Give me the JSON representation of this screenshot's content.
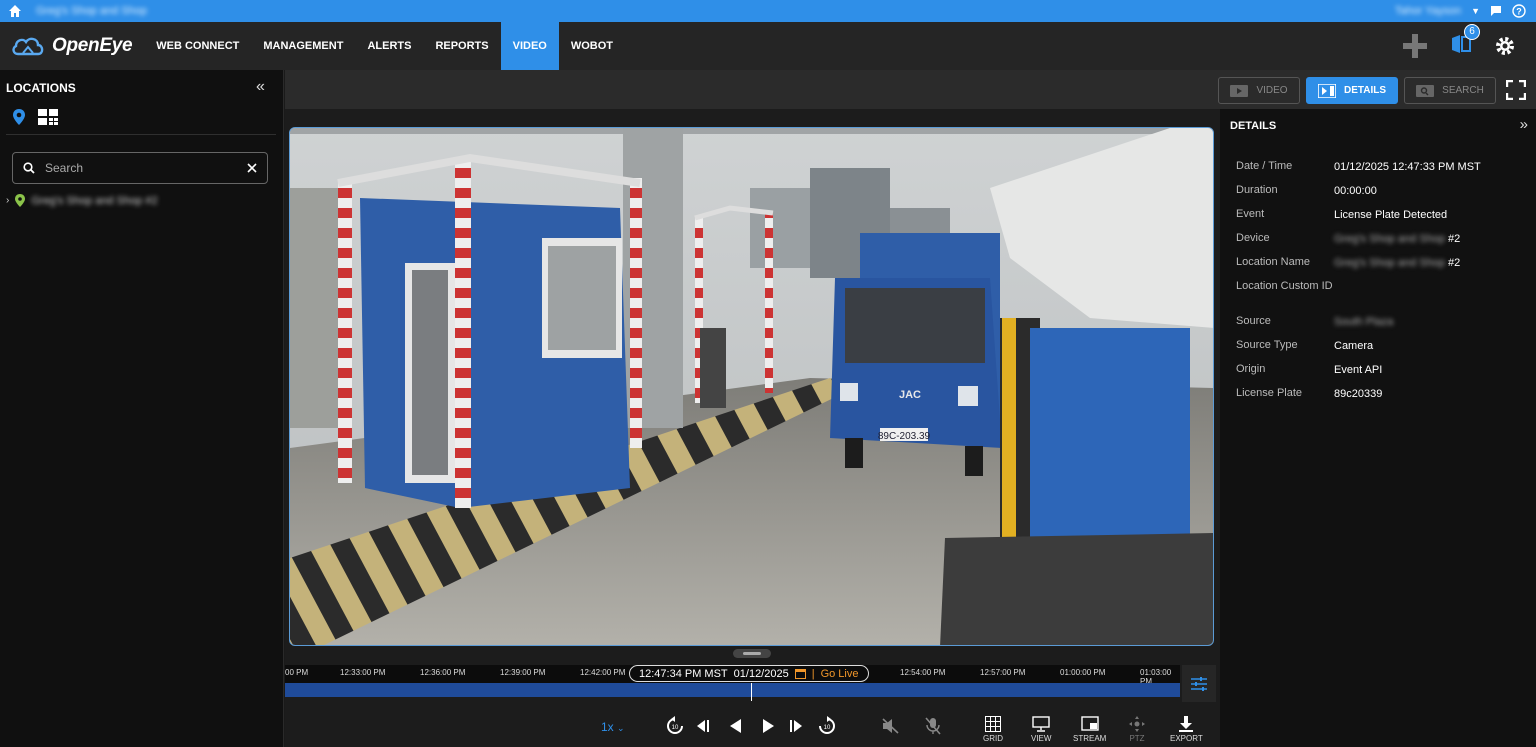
{
  "topbar": {
    "site_name": "Greg's Shop and Shop",
    "user_name": "Tahor Yayson"
  },
  "nav": {
    "brand": "OpenEye",
    "items": [
      "WEB CONNECT",
      "MANAGEMENT",
      "ALERTS",
      "REPORTS",
      "VIDEO",
      "WOBOT"
    ],
    "active": "VIDEO",
    "notification_count": "6"
  },
  "sidebar": {
    "title": "LOCATIONS",
    "search_placeholder": "Search",
    "tree_item": "Greg's Shop and Shop #2"
  },
  "view_toggle": {
    "video": "VIDEO",
    "details": "DETAILS",
    "search": "SEARCH"
  },
  "details": {
    "title": "DETAILS",
    "rows": [
      {
        "label": "Date / Time",
        "value": "01/12/2025 12:47:33 PM MST"
      },
      {
        "label": "Duration",
        "value": "00:00:00"
      },
      {
        "label": "Event",
        "value": "License Plate Detected"
      },
      {
        "label": "Device",
        "value_blur": "Greg's Shop and Shop",
        "value": "#2"
      },
      {
        "label": "Location Name",
        "value_blur": "Greg's Shop and Shop",
        "value": "#2"
      },
      {
        "label": "Location Custom ID",
        "value": ""
      },
      {
        "label": "Source",
        "value_blur": "South Plaza",
        "value": ""
      },
      {
        "label": "Source Type",
        "value": "Camera"
      },
      {
        "label": "Origin",
        "value": "Event API"
      },
      {
        "label": "License Plate",
        "value": "89c20339"
      }
    ]
  },
  "video": {
    "plate_text": "89C-203.39",
    "truck_brand": "JAC"
  },
  "timeline": {
    "ticks": [
      "00 PM",
      "12:33:00 PM",
      "12:36:00 PM",
      "12:39:00 PM",
      "12:42:00 PM",
      "12:54:00 PM",
      "12:57:00 PM",
      "01:00:00 PM",
      "01:03:00 PM"
    ],
    "current_time": "12:47:34 PM MST",
    "current_date": "01/12/2025",
    "separator": "|",
    "go_live": "Go Live"
  },
  "controls": {
    "speed": "1x",
    "grid": "GRID",
    "view": "VIEW",
    "stream": "STREAM",
    "ptz": "PTZ",
    "export": "EXPORT"
  },
  "colors": {
    "accent": "#2f8fe8",
    "live": "#f0962a",
    "timeline_bar": "#1f4b9a"
  }
}
